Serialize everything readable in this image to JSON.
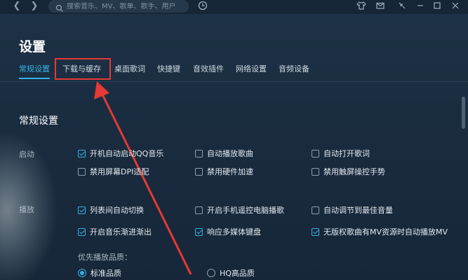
{
  "search": {
    "placeholder": "搜索音乐、MV、歌单、歌手、用户"
  },
  "page": {
    "title": "设置"
  },
  "tabs": [
    {
      "label": "常规设置"
    },
    {
      "label": "下载与缓存"
    },
    {
      "label": "桌面歌词"
    },
    {
      "label": "快捷键"
    },
    {
      "label": "音效插件"
    },
    {
      "label": "网络设置"
    },
    {
      "label": "音频设备"
    }
  ],
  "section": {
    "title": "常规设置"
  },
  "startup": {
    "label": "启动",
    "options": [
      {
        "label": "开机自动启动QQ音乐",
        "checked": true
      },
      {
        "label": "自动播放歌曲",
        "checked": false
      },
      {
        "label": "自动打开歌词",
        "checked": false
      },
      {
        "label": "禁用屏幕DPI适配",
        "checked": false
      },
      {
        "label": "禁用硬件加速",
        "checked": false
      },
      {
        "label": "禁用触屏操控手势",
        "checked": false
      }
    ]
  },
  "playback": {
    "label": "播放",
    "options": [
      {
        "label": "列表间自动切换",
        "checked": true
      },
      {
        "label": "开启手机遥控电脑播歌",
        "checked": false
      },
      {
        "label": "自动调节到最佳音量",
        "checked": false
      },
      {
        "label": "开启音乐渐进渐出",
        "checked": true
      },
      {
        "label": "响应多媒体键盘",
        "checked": true
      },
      {
        "label": "无版权歌曲有MV资源时自动播放MV",
        "checked": true
      }
    ],
    "quality_label": "优先播放品质：",
    "quality_options": [
      {
        "label": "标准品质",
        "selected": true
      },
      {
        "label": "HQ高品质",
        "selected": false
      }
    ]
  },
  "colors": {
    "accent": "#33b3e6",
    "highlight": "#e53935",
    "background": "#1a2b3d"
  },
  "icons": [
    "back-icon",
    "forward-icon",
    "search-icon",
    "history-icon",
    "skin-icon",
    "mail-icon",
    "mini-mode-icon",
    "minimize-icon",
    "maximize-icon",
    "close-icon"
  ]
}
